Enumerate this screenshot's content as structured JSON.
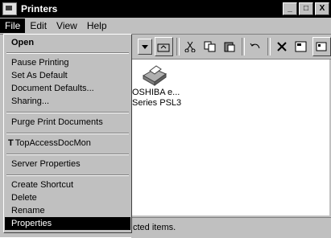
{
  "window": {
    "title": "Printers"
  },
  "title_buttons": [
    "_",
    "□",
    "X"
  ],
  "menubar": [
    {
      "label": "File",
      "active": true
    },
    {
      "label": "Edit"
    },
    {
      "label": "View"
    },
    {
      "label": "Help"
    }
  ],
  "file_menu": {
    "open": "Open",
    "pause_printing": "Pause Printing",
    "set_as_default": "Set As Default",
    "document_defaults": "Document Defaults...",
    "sharing": "Sharing...",
    "purge": "Purge Print Documents",
    "topaccess": "TopAccessDocMon",
    "server_properties": "Server Properties",
    "create_shortcut": "Create Shortcut",
    "delete": "Delete",
    "rename": "Rename",
    "properties": "Properties"
  },
  "printer": {
    "line1": "OSHIBA e...",
    "line2": "Series PSL3"
  },
  "statusbar": {
    "text": "cted items."
  }
}
